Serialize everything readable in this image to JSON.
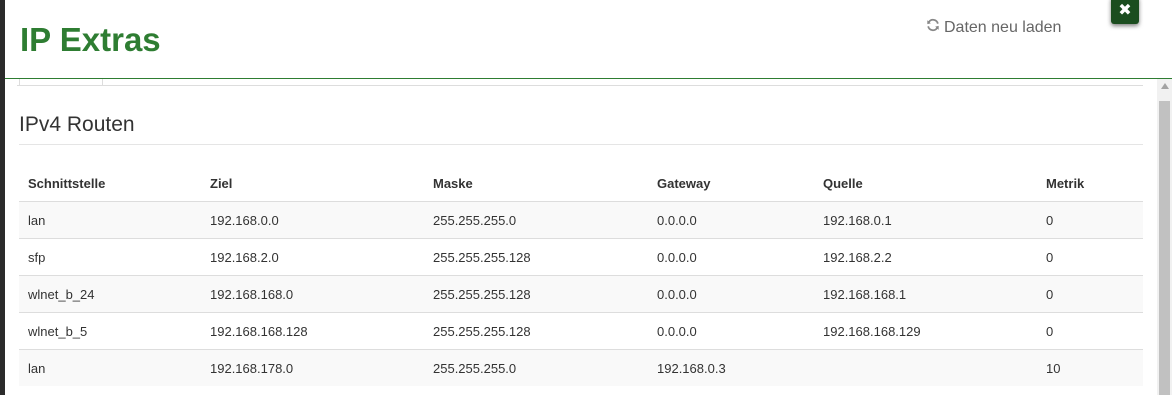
{
  "dialog": {
    "title": "IP Extras",
    "reload_label": "Daten neu laden",
    "close_label": "✖"
  },
  "section": {
    "title": "IPv4 Routen"
  },
  "routes": {
    "headers": [
      "Schnittstelle",
      "Ziel",
      "Maske",
      "Gateway",
      "Quelle",
      "Metrik"
    ],
    "rows": [
      [
        "lan",
        "192.168.0.0",
        "255.255.255.0",
        "0.0.0.0",
        "192.168.0.1",
        "0"
      ],
      [
        "sfp",
        "192.168.2.0",
        "255.255.255.128",
        "0.0.0.0",
        "192.168.2.2",
        "0"
      ],
      [
        "wlnet_b_24",
        "192.168.168.0",
        "255.255.255.128",
        "0.0.0.0",
        "192.168.168.1",
        "0"
      ],
      [
        "wlnet_b_5",
        "192.168.168.128",
        "255.255.255.128",
        "0.0.0.0",
        "192.168.168.129",
        "0"
      ],
      [
        "lan",
        "192.168.178.0",
        "255.255.255.0",
        "192.168.0.3",
        "",
        "10"
      ]
    ]
  },
  "colors": {
    "accent": "#2e7d32",
    "close_button": "#1b4d1f"
  }
}
